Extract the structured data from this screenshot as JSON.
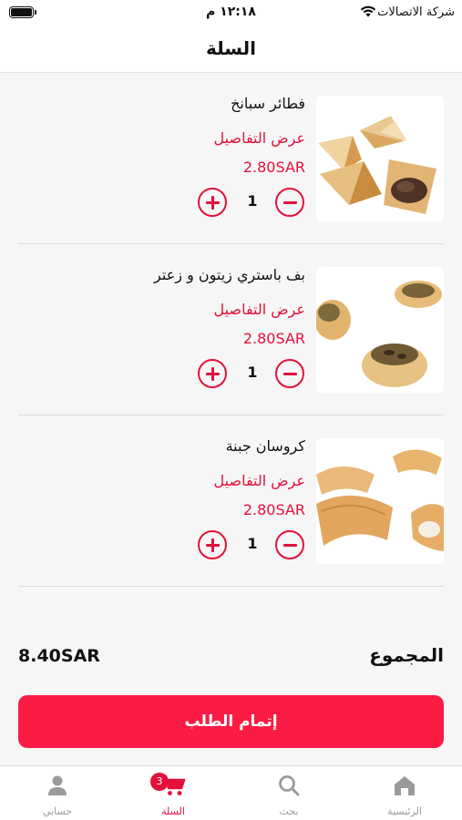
{
  "status_bar": {
    "carrier": "شركة الاتصالات",
    "time": "١٢:١٨ م"
  },
  "header": {
    "title": "السلة"
  },
  "cart": {
    "items": [
      {
        "name": "فطائر سبانخ",
        "details_label": "عرض التفاصيل",
        "price": "2.80SAR",
        "quantity": "1"
      },
      {
        "name": "بف باستري زيتون و زعتر",
        "details_label": "عرض التفاصيل",
        "price": "2.80SAR",
        "quantity": "1"
      },
      {
        "name": "كروسان جبنة",
        "details_label": "عرض التفاصيل",
        "price": "2.80SAR",
        "quantity": "1"
      }
    ]
  },
  "summary": {
    "total_label": "المجموع",
    "total_value": "8.40SAR"
  },
  "checkout": {
    "label": "إتمام الطلب"
  },
  "tabbar": {
    "tabs": [
      {
        "label": "الرئيسية",
        "icon": "home-icon"
      },
      {
        "label": "بحث",
        "icon": "search-icon"
      },
      {
        "label": "السلة",
        "icon": "cart-icon",
        "badge": "3"
      },
      {
        "label": "حسابي",
        "icon": "user-icon"
      }
    ]
  },
  "colors": {
    "accent": "#e3103a",
    "button": "#fa1c45",
    "background": "#f6f6f6"
  }
}
